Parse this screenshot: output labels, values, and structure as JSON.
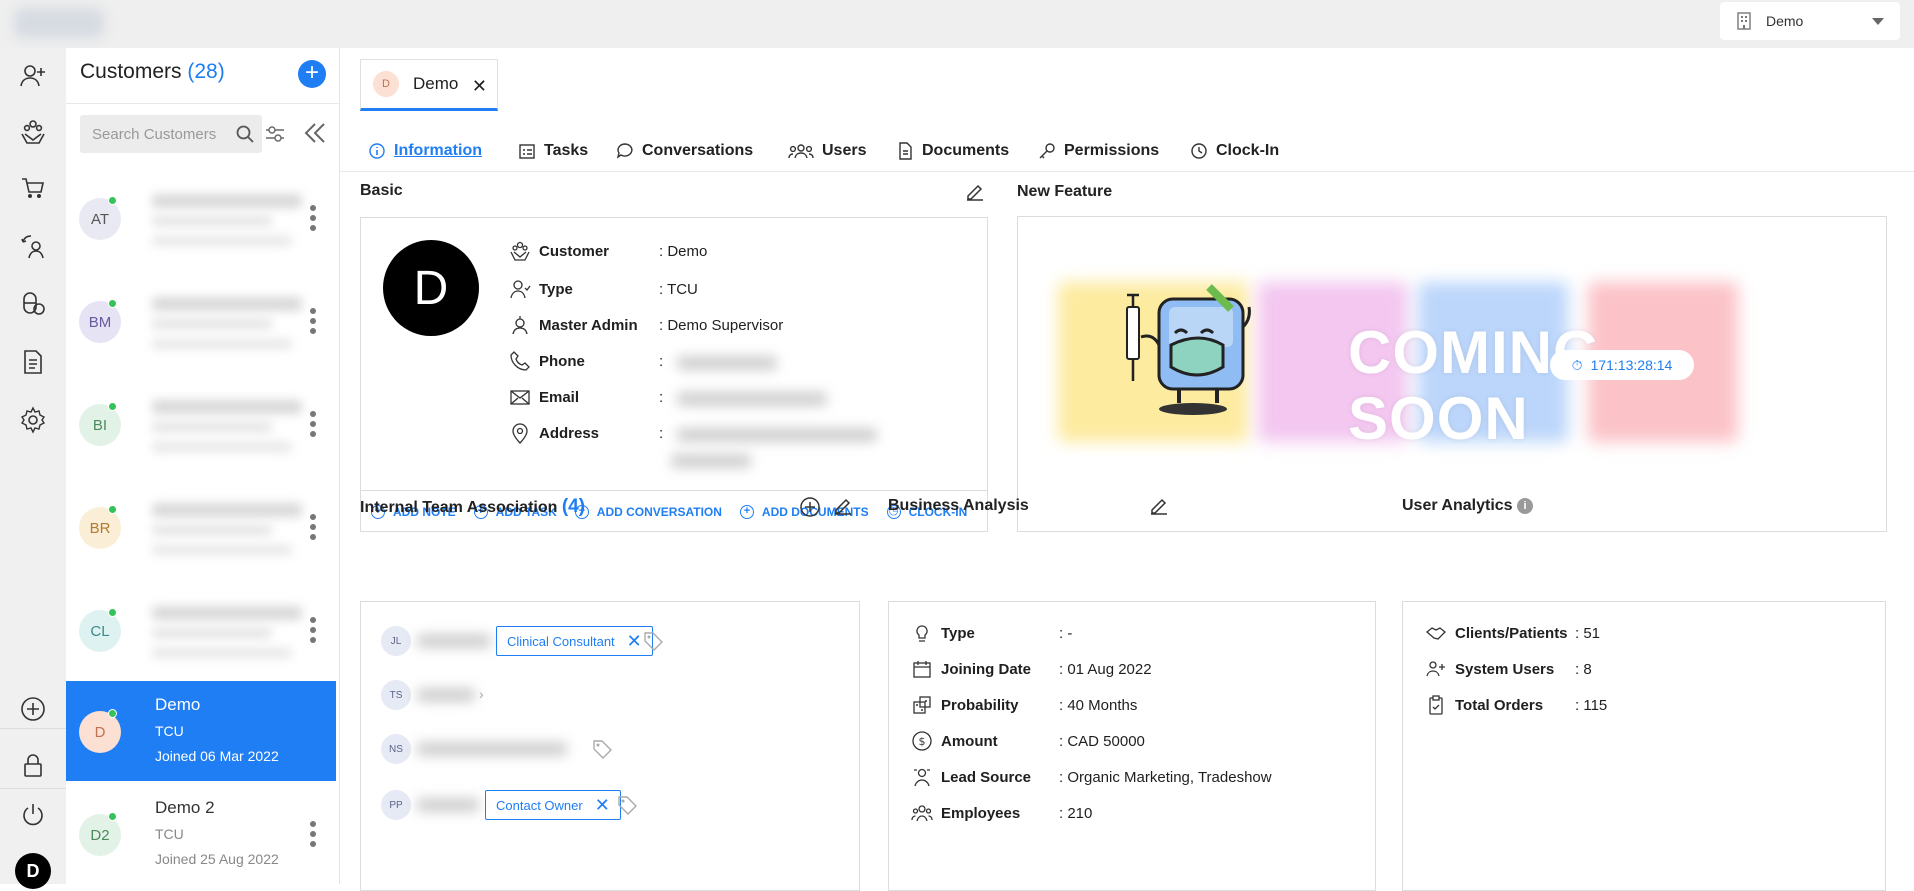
{
  "org": {
    "name": "Demo"
  },
  "user": {
    "initial": "D"
  },
  "customers": {
    "title": "Customers",
    "count": "(28)",
    "search_placeholder": "Search Customers",
    "rows": [
      {
        "initials": "AT",
        "bg": "#e9e9f4",
        "color": "#555"
      },
      {
        "initials": "BM",
        "bg": "#e6e3f5",
        "color": "#6a5aa0"
      },
      {
        "initials": "BI",
        "bg": "#e2f2e6",
        "color": "#4c8a5c"
      },
      {
        "initials": "BR",
        "bg": "#fbeed6",
        "color": "#b07a30"
      },
      {
        "initials": "CL",
        "bg": "#dff2f2",
        "color": "#3c8a8a"
      }
    ],
    "active": {
      "initials": "D",
      "name": "Demo",
      "type": "TCU",
      "joined": "Joined 06 Mar 2022"
    },
    "next": {
      "initials": "D2",
      "name": "Demo 2",
      "type": "TCU",
      "joined": "Joined 25 Aug 2022"
    }
  },
  "profile_tab": {
    "initial": "D",
    "label": "Demo"
  },
  "tabs": [
    "Information",
    "Tasks",
    "Conversations",
    "Users",
    "Documents",
    "Permissions",
    "Clock-In"
  ],
  "basic": {
    "title": "Basic",
    "avatar": "D",
    "fields": [
      {
        "label": "Customer",
        "value": ": Demo"
      },
      {
        "label": "Type",
        "value": ": TCU"
      },
      {
        "label": "Master Admin",
        "value": ": Demo Supervisor"
      },
      {
        "label": "Phone",
        "value": ":"
      },
      {
        "label": "Email",
        "value": ":"
      },
      {
        "label": "Address",
        "value": ":"
      }
    ],
    "actions": [
      "ADD NOTE",
      "ADD TASK",
      "ADD CONVERSATION",
      "ADD DOCUMENTS",
      "CLOCK-IN"
    ]
  },
  "new_feature": {
    "title": "New Feature",
    "line1": "COMING",
    "line2": "SOON",
    "timer": "171:13:28:14"
  },
  "team": {
    "title": "Internal Team Association",
    "count": "(4)",
    "members": [
      {
        "initials": "JL",
        "tag": "Clinical Consultant"
      },
      {
        "initials": "TS",
        "tag": ""
      },
      {
        "initials": "NS",
        "tag": ""
      },
      {
        "initials": "PP",
        "tag": "Contact Owner"
      }
    ]
  },
  "business": {
    "title": "Business Analysis",
    "fields": [
      {
        "label": "Type",
        "value": ": -"
      },
      {
        "label": "Joining Date",
        "value": ": 01 Aug 2022"
      },
      {
        "label": "Probability",
        "value": ": 40 Months"
      },
      {
        "label": "Amount",
        "value": ": CAD 50000"
      },
      {
        "label": "Lead Source",
        "value": ": Organic Marketing, Tradeshow"
      },
      {
        "label": "Employees",
        "value": ": 210"
      }
    ]
  },
  "user_analytics": {
    "title": "User Analytics",
    "fields": [
      {
        "label": "Clients/Patients",
        "value": ": 51"
      },
      {
        "label": "System Users",
        "value": ": 8"
      },
      {
        "label": "Total Orders",
        "value": ": 115"
      }
    ]
  },
  "colors": {
    "accent": "#1f7ef3",
    "online": "#36c25a"
  }
}
